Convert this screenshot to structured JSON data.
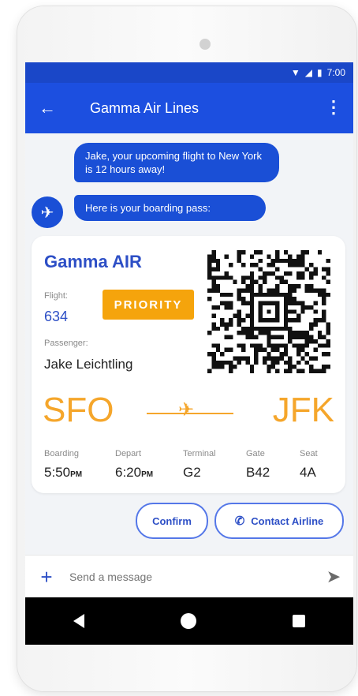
{
  "status_bar": {
    "time": "7:00"
  },
  "header": {
    "title": "Gamma Air Lines"
  },
  "messages": [
    "Jake, your upcoming flight to New York is 12 hours away!",
    "Here is your boarding pass:"
  ],
  "boarding_pass": {
    "airline": "Gamma AIR",
    "flight_label": "Flight:",
    "flight": "634",
    "priority": "PRIORITY",
    "passenger_label": "Passenger:",
    "passenger": "Jake Leichtling",
    "origin": "SFO",
    "destination": "JFK",
    "details": [
      {
        "label": "Boarding",
        "value": "5:50",
        "suffix": "PM"
      },
      {
        "label": "Depart",
        "value": "6:20",
        "suffix": "PM"
      },
      {
        "label": "Terminal",
        "value": "G2",
        "suffix": ""
      },
      {
        "label": "Gate",
        "value": "B42",
        "suffix": ""
      },
      {
        "label": "Seat",
        "value": "4A",
        "suffix": ""
      }
    ]
  },
  "actions": {
    "confirm": "Confirm",
    "contact": "Contact Airline"
  },
  "composer": {
    "placeholder": "Send a message"
  },
  "colors": {
    "primary": "#1c4fe0",
    "accent": "#f5a62b",
    "priority": "#f5a40c"
  }
}
